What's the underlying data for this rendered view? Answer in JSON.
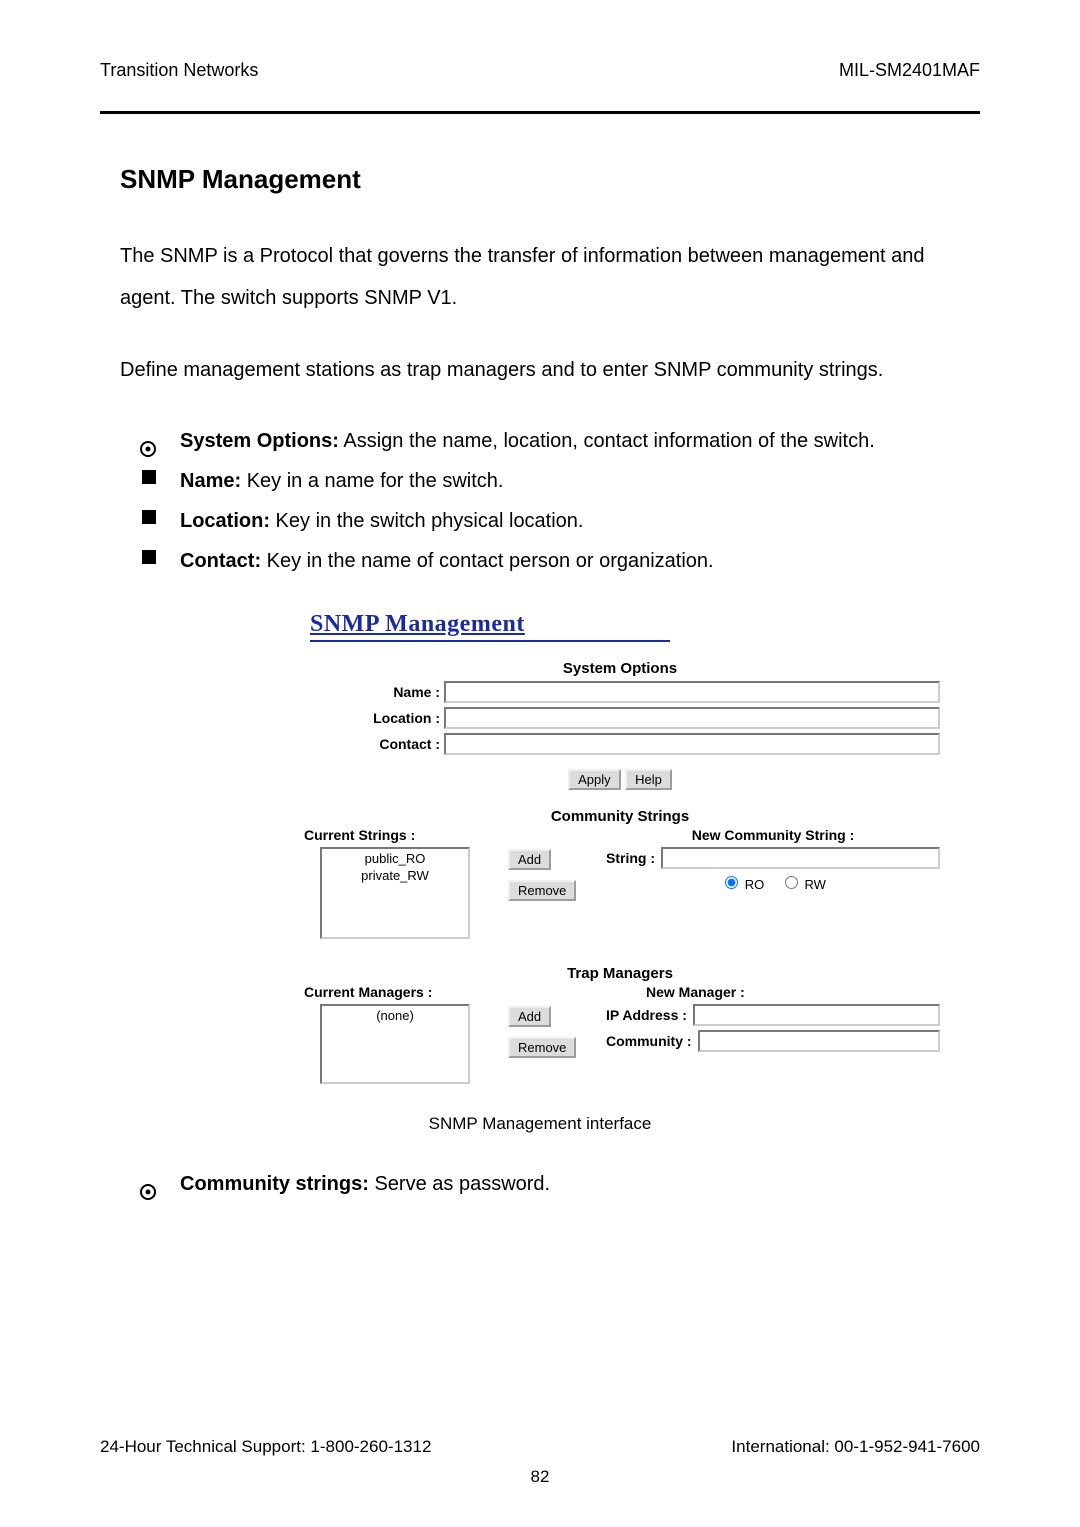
{
  "header": {
    "left": "Transition Networks",
    "right": "MIL-SM2401MAF"
  },
  "title": "SNMP Management",
  "intro1": "The SNMP is a Protocol that governs the transfer of information between management and agent. The switch supports SNMP V1.",
  "intro2": "Define management stations as trap managers and to enter SNMP community strings.",
  "bullets": {
    "b1": {
      "label": "System Options:",
      "text": " Assign the name, location, contact information of the switch."
    },
    "b2": {
      "label": "Name:",
      "text": " Key in a name for the switch."
    },
    "b3": {
      "label": "Location:",
      "text": " Key in the switch physical location."
    },
    "b4": {
      "label": "Contact:",
      "text": " Key in the name of contact person or organization."
    }
  },
  "ui": {
    "title": "SNMP Management",
    "system_options_title": "System Options",
    "fields": {
      "name": {
        "label": "Name :",
        "value": ""
      },
      "location": {
        "label": "Location :",
        "value": ""
      },
      "contact": {
        "label": "Contact :",
        "value": ""
      }
    },
    "buttons": {
      "apply": "Apply",
      "help": "Help",
      "add": "Add",
      "remove": "Remove"
    },
    "community": {
      "title": "Community Strings",
      "current_label": "Current Strings :",
      "current": [
        "public_RO",
        "private_RW"
      ],
      "new_label": "New Community String :",
      "string_label": "String :",
      "string_value": "",
      "ro_label": "RO",
      "rw_label": "RW",
      "selected": "RO"
    },
    "trap": {
      "title": "Trap Managers",
      "current_label": "Current Managers :",
      "current": [
        "(none)"
      ],
      "new_label": "New Manager :",
      "ip_label": "IP Address :",
      "ip_value": "",
      "community_label": "Community :",
      "community_value": ""
    }
  },
  "caption": "SNMP Management interface",
  "last_bullet": {
    "label": "Community strings:",
    "text": " Serve as password."
  },
  "footer": {
    "left": "24-Hour Technical Support: 1-800-260-1312",
    "right": "International: 00-1-952-941-7600",
    "page": "82"
  }
}
